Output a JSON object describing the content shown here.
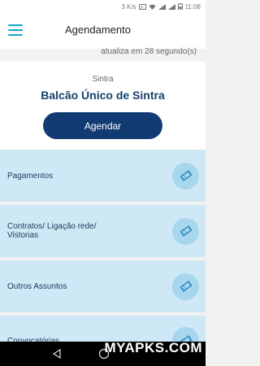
{
  "status_bar": {
    "speed": "3 K/s",
    "time": "11:08"
  },
  "header": {
    "title": "Agendamento"
  },
  "update_text": "atualiza em 28 segundo(s)",
  "hero": {
    "subtitle": "Sintra",
    "location": "Balcão Único de Sintra",
    "cta_label": "Agendar"
  },
  "services": [
    {
      "label": "Pagamentos"
    },
    {
      "label": "Contratos/ Ligação rede/\nVistorias"
    },
    {
      "label": "Outros Assuntos"
    },
    {
      "label": "Convocatórias"
    }
  ],
  "watermark": "MYAPKS.COM",
  "colors": {
    "accent": "#1aa3c6",
    "brand": "#123b73",
    "list_bg": "#cfe8f5",
    "icon_bg": "#a7d6ee"
  }
}
